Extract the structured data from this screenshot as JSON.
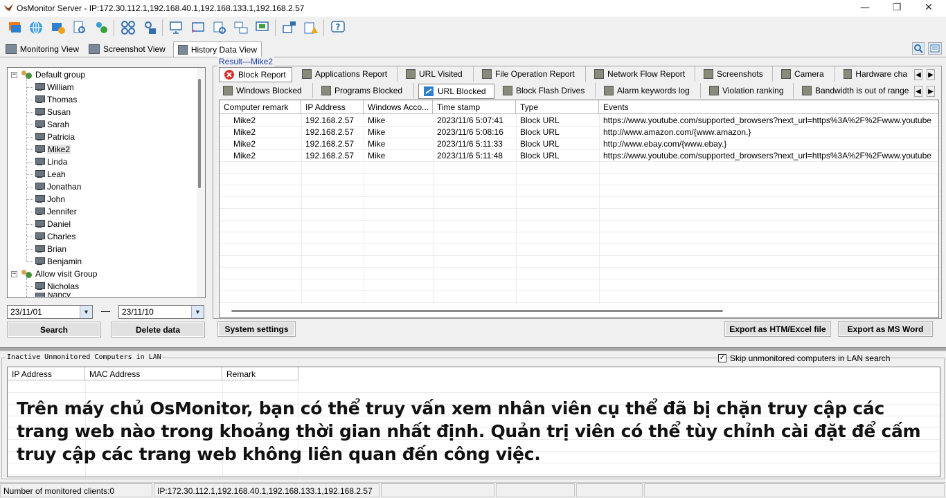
{
  "window": {
    "title": "OsMonitor Server  -  IP:172.30.112.1,192.168.40.1,192.168.133.1,192.168.2.57",
    "min_glyph": "—",
    "max_glyph": "❐",
    "close_glyph": "✕"
  },
  "toolbar": {
    "icons": [
      "windows-icon",
      "globe-icon",
      "folder-settings-icon",
      "file-search-icon",
      "users-settings-icon",
      "grid-icon",
      "lock-user-icon",
      "remote-screen-icon",
      "cast-icon",
      "search-list-icon",
      "network-monitor-icon",
      "display-icon",
      "ip-config-icon",
      "alarm-icon",
      "help-icon"
    ],
    "help_glyph": "?"
  },
  "view_tabs": [
    {
      "label": "Monitoring View"
    },
    {
      "label": "Screenshot View"
    },
    {
      "label": "History Data View"
    }
  ],
  "tree": {
    "groups": [
      {
        "label": "Default group",
        "expander": "−"
      },
      {
        "label": "Allow visit Group",
        "expander": "−"
      }
    ],
    "default_members": [
      "William",
      "Thomas",
      "Susan",
      "Sarah",
      "Patricia",
      "Mike2",
      "Linda",
      "Leah",
      "Jonathan",
      "John",
      "Jennifer",
      "Daniel",
      "Charles",
      "Brian",
      "Benjamin"
    ],
    "allow_members": [
      "Nicholas",
      "Nancy"
    ],
    "selected": "Mike2"
  },
  "date_range": {
    "from": "23/11/01",
    "to": "23/11/10",
    "separator": "—",
    "dropdown_glyph": "▼"
  },
  "buttons": {
    "search": "Search",
    "delete": "Delete data",
    "system_settings": "System settings",
    "export_htm": "Export as HTM/Excel file",
    "export_word": "Export as MS Word"
  },
  "result": {
    "label": "Result---Mike2",
    "tabs_row1": [
      "Block Report",
      "Applications Report",
      "URL Visited",
      "File Operation Report",
      "Network Flow Report",
      "Screenshots",
      "Camera",
      "Hardware cha"
    ],
    "tabs_row2": [
      "Windows Blocked",
      "Programs Blocked",
      "URL Blocked",
      "Block Flash Drives",
      "Alarm keywords log",
      "Violation ranking",
      "Bandwidth is out of range"
    ],
    "active_row1": "Block Report",
    "active_row2": "URL Blocked",
    "arrow_left": "◀",
    "arrow_right": "▶"
  },
  "grid": {
    "columns": [
      "Computer remark",
      "IP Address",
      "Windows Acco...",
      "Time stamp",
      "Type",
      "Events"
    ],
    "rows": [
      [
        "Mike2",
        "192.168.2.57",
        "Mike",
        "2023/11/6 5:07:41",
        "Block URL",
        "https://www.youtube.com/supported_browsers?next_url=https%3A%2F%2Fwww.youtube"
      ],
      [
        "Mike2",
        "192.168.2.57",
        "Mike",
        "2023/11/6 5:08:16",
        "Block URL",
        "http://www.amazon.com/{www.amazon.}"
      ],
      [
        "Mike2",
        "192.168.2.57",
        "Mike",
        "2023/11/6 5:11:33",
        "Block URL",
        "http://www.ebay.com/{www.ebay.}"
      ],
      [
        "Mike2",
        "192.168.2.57",
        "Mike",
        "2023/11/6 5:11:48",
        "Block URL",
        "https://www.youtube.com/supported_browsers?next_url=https%3A%2F%2Fwww.youtube"
      ]
    ]
  },
  "inactive": {
    "label": "Inactive Unmonitored Computers in LAN",
    "skip_label": "Skip unmonitored computers in LAN search",
    "skip_checked": "✓",
    "columns": [
      "IP Address",
      "MAC Address",
      "Remark"
    ],
    "caption": "Trên máy chủ OsMonitor, bạn có thể truy vấn xem nhân viên cụ thể đã bị chặn truy cập các trang web nào trong khoảng thời gian nhất định. Quản trị viên có thể tùy chỉnh cài đặt để cấm truy cập các trang web không liên quan đến công việc."
  },
  "status": {
    "clients": "Number of monitored clients:0",
    "ips": "IP:172.30.112.1,192.168.40.1,192.168.133.1,192.168.2.57"
  },
  "colors": {
    "accent_blue": "#1a3ea8",
    "block_red": "#d9302b"
  }
}
